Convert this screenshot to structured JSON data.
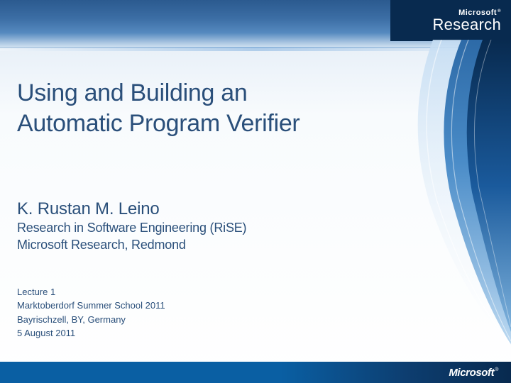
{
  "logo": {
    "company": "Microsoft",
    "division": "Research"
  },
  "slide": {
    "title_line1": "Using and Building an",
    "title_line2": "Automatic Program Verifier",
    "author": "K. Rustan M. Leino",
    "affiliation_line1": "Research in Software Engineering (RiSE)",
    "affiliation_line2": "Microsoft Research, Redmond",
    "lecture": "Lecture 1",
    "event": "Marktoberdorf Summer School 2011",
    "location": "Bayrischzell, BY, Germany",
    "date": "5 August 2011"
  },
  "footer": {
    "company": "Microsoft"
  }
}
